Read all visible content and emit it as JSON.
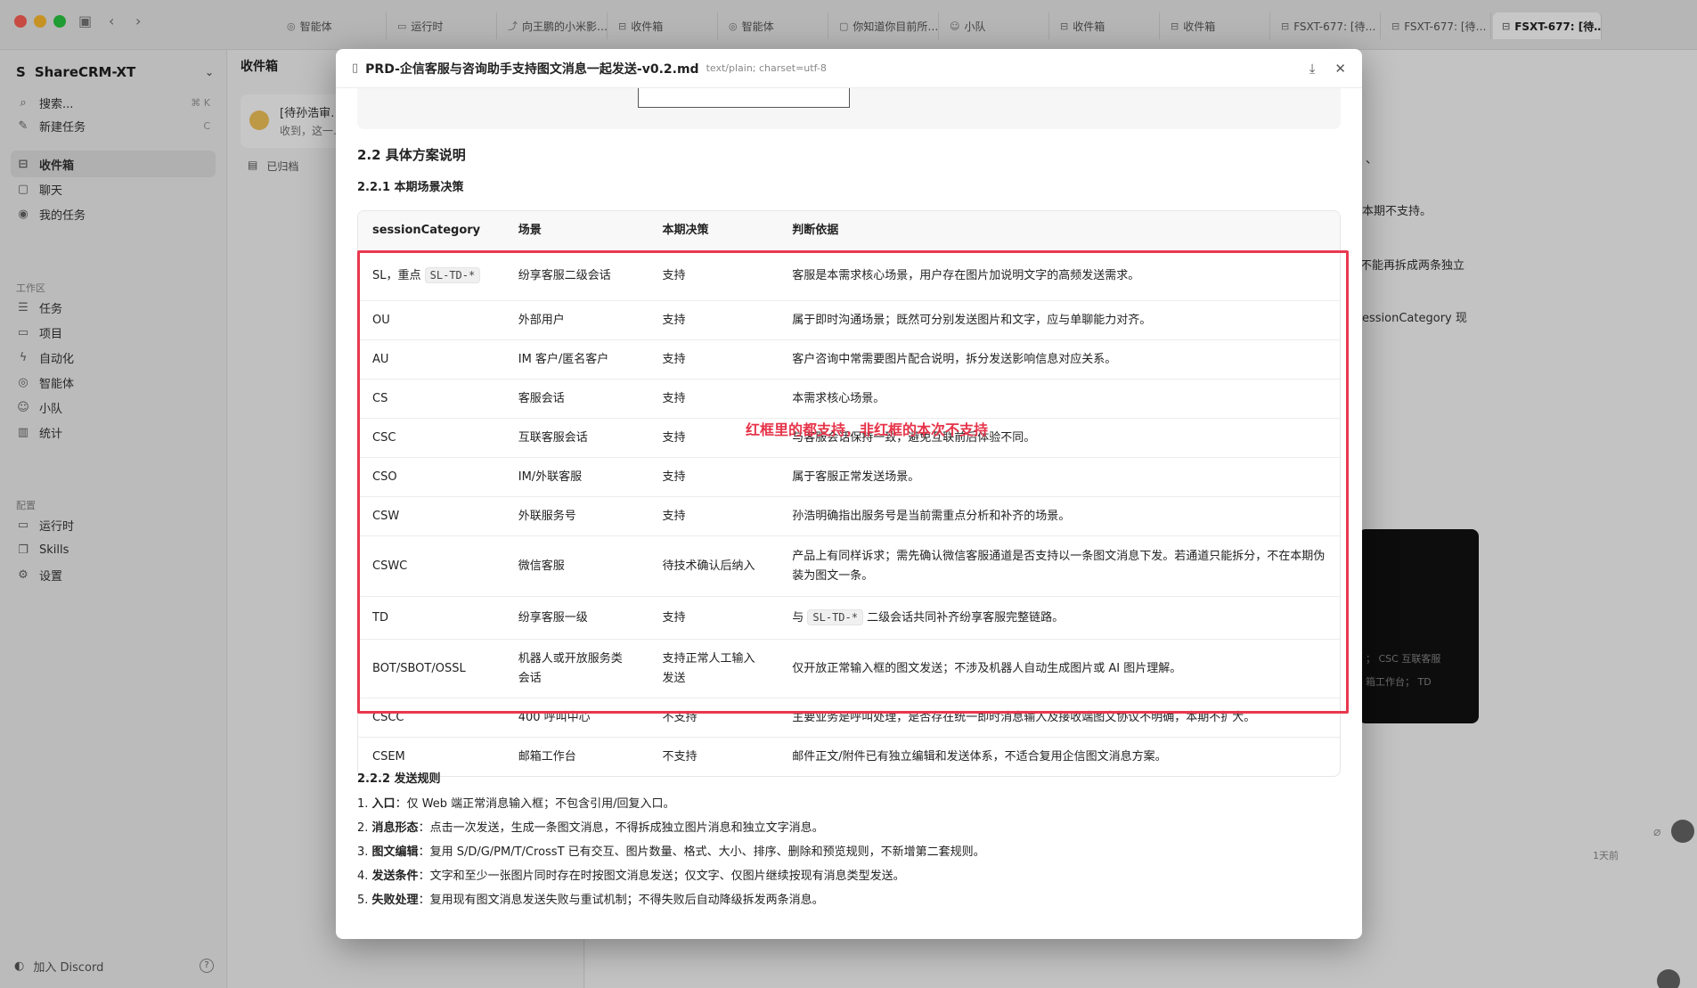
{
  "titlebar": {
    "tabs": [
      {
        "label": "智能体",
        "icon": "robot-icon"
      },
      {
        "label": "运行时",
        "icon": "monitor-icon"
      },
      {
        "label": "向王鹏的小米影…",
        "icon": "share-icon"
      },
      {
        "label": "收件箱",
        "icon": "inbox-icon"
      },
      {
        "label": "智能体",
        "icon": "robot-icon"
      },
      {
        "label": "你知道你目前所…",
        "icon": "chat-icon"
      },
      {
        "label": "小队",
        "icon": "users-icon"
      },
      {
        "label": "收件箱",
        "icon": "inbox-icon"
      },
      {
        "label": "收件箱",
        "icon": "inbox-icon"
      },
      {
        "label": "FSXT-677: [待…",
        "icon": "inbox-icon"
      },
      {
        "label": "FSXT-677: [待…",
        "icon": "inbox-icon"
      },
      {
        "label": "FSXT-677: [待…",
        "icon": "inbox-icon"
      }
    ]
  },
  "sidebar": {
    "workspace": "ShareCRM-XT",
    "search": "搜索...",
    "search_kbd": "⌘ K",
    "new_task": "新建任务",
    "new_task_kbd": "C",
    "inbox": "收件箱",
    "chat": "聊天",
    "my_tasks": "我的任务",
    "section_workspace": "工作区",
    "items_workspace": [
      "任务",
      "项目",
      "自动化",
      "智能体",
      "小队",
      "统计"
    ],
    "section_config": "配置",
    "items_config": [
      "运行时",
      "Skills",
      "设置"
    ],
    "discord": "加入 Discord"
  },
  "inbox": {
    "title": "收件箱",
    "item_title": "[待孙浩审…",
    "item_preview": "收到，这一…",
    "archived": "已归档"
  },
  "main_fragments": {
    "f1": "、",
    "f2": "本期不支持。",
    "f3": "不能再拆成两条独立",
    "f4": "essionCategory 现",
    "time": "1天前",
    "dark1": "； CSC 互联客服",
    "dark2": "箱工作台； TD"
  },
  "modal": {
    "title": "PRD-企信客服与咨询助手支持图文消息一起发送-v0.2.md",
    "mime": "text/plain; charset=utf-8",
    "section_22": "2.2 具体方案说明",
    "section_221": "2.2.1 本期场景决策",
    "table_headers": [
      "sessionCategory",
      "场景",
      "本期决策",
      "判断依据"
    ],
    "rows": [
      {
        "cat": "SL，重点",
        "cat_code": "SL-TD-*",
        "scene": "纷享客服二级会话",
        "decision": "支持",
        "basis": "客服是本需求核心场景，用户存在图片加说明文字的高频发送需求。"
      },
      {
        "cat": "OU",
        "scene": "外部用户",
        "decision": "支持",
        "basis": "属于即时沟通场景；既然可分别发送图片和文字，应与单聊能力对齐。"
      },
      {
        "cat": "AU",
        "scene": "IM 客户/匿名客户",
        "decision": "支持",
        "basis": "客户咨询中常需要图片配合说明，拆分发送影响信息对应关系。"
      },
      {
        "cat": "CS",
        "scene": "客服会话",
        "decision": "支持",
        "basis": "本需求核心场景。"
      },
      {
        "cat": "CSC",
        "scene": "互联客服会话",
        "decision": "支持",
        "basis": "与客服会话保持一致，避免互联前后体验不同。"
      },
      {
        "cat": "CSO",
        "scene": "IM/外联客服",
        "decision": "支持",
        "basis": "属于客服正常发送场景。"
      },
      {
        "cat": "CSW",
        "scene": "外联服务号",
        "decision": "支持",
        "basis": "孙浩明确指出服务号是当前需重点分析和补齐的场景。"
      },
      {
        "cat": "CSWC",
        "scene": "微信客服",
        "decision": "待技术确认后纳入",
        "basis": "产品上有同样诉求；需先确认微信客服通道是否支持以一条图文消息下发。若通道只能拆分，不在本期伪装为图文一条。"
      },
      {
        "cat": "TD",
        "scene": "纷享客服一级",
        "decision": "支持",
        "basis_pre": "与",
        "basis_code": "SL-TD-*",
        "basis": "二级会话共同补齐纷享客服完整链路。"
      },
      {
        "cat": "BOT/SBOT/OSSL",
        "scene": "机器人或开放服务类会话",
        "decision": "支持正常人工输入发送",
        "basis": "仅开放正常输入框的图文发送；不涉及机器人自动生成图片或 AI 图片理解。"
      },
      {
        "cat": "CSCC",
        "scene": "400 呼叫中心",
        "decision": "不支持",
        "basis": "主要业务是呼叫处理，是否存在统一即时消息输入及接收端图文协议不明确，本期不扩大。"
      },
      {
        "cat": "CSEM",
        "scene": "邮箱工作台",
        "decision": "不支持",
        "basis": "邮件正文/附件已有独立编辑和发送体系，不适合复用企信图文消息方案。"
      }
    ],
    "annotation": "红框里的都支持，非红框的本次不支持",
    "section_222": "2.2.2 发送规则",
    "rules": [
      {
        "key": "入口",
        "text": "：仅 Web 端正常消息输入框；不包含引用/回复入口。"
      },
      {
        "key": "消息形态",
        "text": "：点击一次发送，生成一条图文消息，不得拆成独立图片消息和独立文字消息。"
      },
      {
        "key": "图文编辑",
        "text": "：复用 S/D/G/PM/T/CrossT 已有交互、图片数量、格式、大小、排序、删除和预览规则，不新增第二套规则。"
      },
      {
        "key": "发送条件",
        "text": "：文字和至少一张图片同时存在时按图文消息发送；仅文字、仅图片继续按现有消息类型发送。"
      },
      {
        "key": "失败处理",
        "text": "：复用现有图文消息发送失败与重试机制；不得失败后自动降级拆发两条消息。"
      }
    ]
  }
}
